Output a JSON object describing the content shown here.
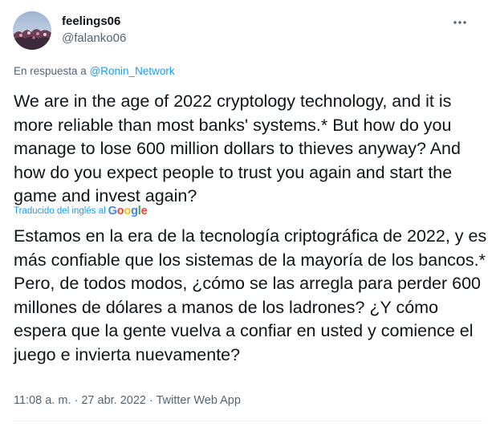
{
  "author": {
    "display_name": "feelings06",
    "handle": "@falanko06"
  },
  "reply": {
    "prefix": "En respuesta a",
    "mention": "@Ronin_Network"
  },
  "tweet": {
    "original_text": "We are in the age of 2022 cryptology technology, and it is more reliable than most banks' systems.* But how do you manage to lose 600 million dollars to thieves anyway? And how do you expect people to trust you again and start the game and invest again?",
    "translated_by_label": "Traducido del inglés al",
    "translator_logo": [
      "G",
      "o",
      "o",
      "g",
      "l",
      "e"
    ],
    "translated_text": "Estamos en la era de la tecnología criptográfica de 2022, y es más confiable que los sistemas de la mayoría de los bancos.* Pero, de todos modos, ¿cómo se las arregla para perder 600 millones de dólares a manos de los ladrones? ¿Y cómo espera que la gente vuelva a confiar en usted y comience el juego e invierta nuevamente?"
  },
  "meta": {
    "time": "11:08 a. m.",
    "separator": " · ",
    "date": "27 abr. 2022",
    "source": "Twitter Web App"
  },
  "icons": {
    "more": "more-horizontal-icon"
  },
  "colors": {
    "link": "#1d9bf0",
    "secondary": "#536471",
    "text": "#0f1419",
    "google_blue": "#4285f4",
    "google_red": "#ea4335",
    "google_yellow": "#fbbc05",
    "google_green": "#34a853"
  }
}
